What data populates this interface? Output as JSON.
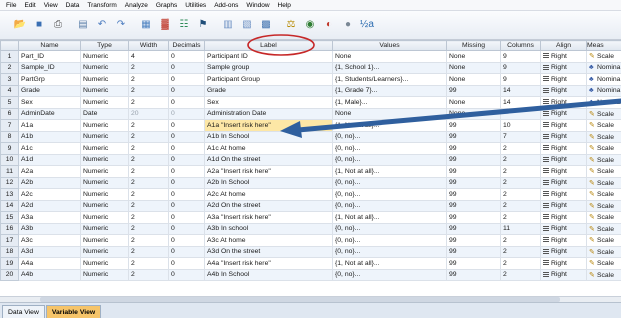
{
  "menu": [
    "File",
    "Edit",
    "View",
    "Data",
    "Transform",
    "Analyze",
    "Graphs",
    "Utilities",
    "Add-ons",
    "Window",
    "Help"
  ],
  "toolbar": {
    "icons": [
      {
        "name": "open-folder-icon",
        "glyph": "📂",
        "color": "#d9a520"
      },
      {
        "name": "save-icon",
        "glyph": "■",
        "color": "#3a6fb3"
      },
      {
        "name": "print-icon",
        "glyph": "⎙",
        "color": "#555555"
      },
      {
        "name": "dialog-recall-icon",
        "glyph": "▤",
        "color": "#5b7fa8"
      },
      {
        "name": "undo-icon",
        "glyph": "↶",
        "color": "#4a7bbf"
      },
      {
        "name": "redo-icon",
        "glyph": "↷",
        "color": "#4a7bbf"
      },
      {
        "name": "goto-case-icon",
        "glyph": "▦",
        "color": "#4a80c0"
      },
      {
        "name": "goto-variable-icon",
        "glyph": "▓",
        "color": "#c0392b"
      },
      {
        "name": "variables-icon",
        "glyph": "☷",
        "color": "#2e8b57"
      },
      {
        "name": "find-icon",
        "glyph": "⚑",
        "color": "#1f4e79"
      },
      {
        "name": "insert-cases-icon",
        "glyph": "▥",
        "color": "#6b8fc2"
      },
      {
        "name": "insert-variable-icon",
        "glyph": "▧",
        "color": "#6b8fc2"
      },
      {
        "name": "split-file-icon",
        "glyph": "▩",
        "color": "#3b6fae"
      },
      {
        "name": "weight-cases-icon",
        "glyph": "⚖",
        "color": "#b58900"
      },
      {
        "name": "select-cases-icon",
        "glyph": "◉",
        "color": "#2e7d32"
      },
      {
        "name": "value-labels-icon",
        "glyph": "◐",
        "color": "#c0392b"
      },
      {
        "name": "use-sets-icon",
        "glyph": "●",
        "color": "#7a8895"
      },
      {
        "name": "spell-check-icon",
        "glyph": "½a",
        "color": "#2b6cb0"
      }
    ]
  },
  "columns": [
    "Name",
    "Type",
    "Width",
    "Decimals",
    "Label",
    "Values",
    "Missing",
    "Columns",
    "Align",
    "Meas"
  ],
  "rows": [
    {
      "n": "1",
      "name": "Part_ID",
      "type": "Numeric",
      "width": "4",
      "dec": "0",
      "label": "Participant ID",
      "values": "None",
      "missing": "None",
      "columns": "9",
      "align": "Right",
      "meas": "Scale",
      "meas_icon": "scale"
    },
    {
      "n": "2",
      "name": "Sample_ID",
      "type": "Numeric",
      "width": "2",
      "dec": "0",
      "label": "Sample group",
      "values": "{1, School 1}...",
      "missing": "None",
      "columns": "9",
      "align": "Right",
      "meas": "Nomina",
      "meas_icon": "nominal"
    },
    {
      "n": "3",
      "name": "PartGrp",
      "type": "Numeric",
      "width": "2",
      "dec": "0",
      "label": "Participant Group",
      "values": "{1, Students/Learners}...",
      "missing": "None",
      "columns": "9",
      "align": "Right",
      "meas": "Nomina",
      "meas_icon": "nominal"
    },
    {
      "n": "4",
      "name": "Grade",
      "type": "Numeric",
      "width": "2",
      "dec": "0",
      "label": "Grade",
      "values": "{1, Grade 7}...",
      "missing": "99",
      "columns": "14",
      "align": "Right",
      "meas": "Nomina",
      "meas_icon": "nominal"
    },
    {
      "n": "5",
      "name": "Sex",
      "type": "Numeric",
      "width": "2",
      "dec": "0",
      "label": "Sex",
      "values": "{1, Male}...",
      "missing": "None",
      "columns": "14",
      "align": "Right",
      "meas": "Nomina",
      "meas_icon": "nominal"
    },
    {
      "n": "6",
      "name": "AdminDate",
      "type": "Date",
      "width": "20",
      "dec": "0",
      "label": "Administration Date",
      "values": "None",
      "missing": "None",
      "columns": "",
      "align": "Right",
      "meas": "Scale",
      "meas_icon": "scale"
    },
    {
      "n": "7",
      "name": "A1a",
      "type": "Numeric",
      "width": "2",
      "dec": "0",
      "label": "A1a \"Insert risk here\"",
      "values": "{1, Not at all}...",
      "missing": "99",
      "columns": "10",
      "align": "Right",
      "meas": "Scale",
      "meas_icon": "scale"
    },
    {
      "n": "8",
      "name": "A1b",
      "type": "Numeric",
      "width": "2",
      "dec": "0",
      "label": "A1b In School",
      "values": "{0, no}...",
      "missing": "99",
      "columns": "7",
      "align": "Right",
      "meas": "Scale",
      "meas_icon": "scale"
    },
    {
      "n": "9",
      "name": "A1c",
      "type": "Numeric",
      "width": "2",
      "dec": "0",
      "label": "A1c At home",
      "values": "{0, no}...",
      "missing": "99",
      "columns": "2",
      "align": "Right",
      "meas": "Scale",
      "meas_icon": "scale"
    },
    {
      "n": "10",
      "name": "A1d",
      "type": "Numeric",
      "width": "2",
      "dec": "0",
      "label": "A1d On the street",
      "values": "{0, no}...",
      "missing": "99",
      "columns": "2",
      "align": "Right",
      "meas": "Scale",
      "meas_icon": "scale"
    },
    {
      "n": "11",
      "name": "A2a",
      "type": "Numeric",
      "width": "2",
      "dec": "0",
      "label": "A2a \"Insert risk here\"",
      "values": "{1, Not at all}...",
      "missing": "99",
      "columns": "2",
      "align": "Right",
      "meas": "Scale",
      "meas_icon": "scale"
    },
    {
      "n": "12",
      "name": "A2b",
      "type": "Numeric",
      "width": "2",
      "dec": "0",
      "label": "A2b In School",
      "values": "{0, no}...",
      "missing": "99",
      "columns": "2",
      "align": "Right",
      "meas": "Scale",
      "meas_icon": "scale"
    },
    {
      "n": "13",
      "name": "A2c",
      "type": "Numeric",
      "width": "2",
      "dec": "0",
      "label": "A2c At home",
      "values": "{0, no}...",
      "missing": "99",
      "columns": "2",
      "align": "Right",
      "meas": "Scale",
      "meas_icon": "scale"
    },
    {
      "n": "14",
      "name": "A2d",
      "type": "Numeric",
      "width": "2",
      "dec": "0",
      "label": "A2d On the street",
      "values": "{0, no}...",
      "missing": "99",
      "columns": "2",
      "align": "Right",
      "meas": "Scale",
      "meas_icon": "scale"
    },
    {
      "n": "15",
      "name": "A3a",
      "type": "Numeric",
      "width": "2",
      "dec": "0",
      "label": "A3a \"Insert risk here\"",
      "values": "{1, Not at all}...",
      "missing": "99",
      "columns": "2",
      "align": "Right",
      "meas": "Scale",
      "meas_icon": "scale"
    },
    {
      "n": "16",
      "name": "A3b",
      "type": "Numeric",
      "width": "2",
      "dec": "0",
      "label": "A3b In school",
      "values": "{0, no}...",
      "missing": "99",
      "columns": "11",
      "align": "Right",
      "meas": "Scale",
      "meas_icon": "scale"
    },
    {
      "n": "17",
      "name": "A3c",
      "type": "Numeric",
      "width": "2",
      "dec": "0",
      "label": "A3c At home",
      "values": "{0, no}...",
      "missing": "99",
      "columns": "2",
      "align": "Right",
      "meas": "Scale",
      "meas_icon": "scale"
    },
    {
      "n": "18",
      "name": "A3d",
      "type": "Numeric",
      "width": "2",
      "dec": "0",
      "label": "A3d On the street",
      "values": "{0, no}...",
      "missing": "99",
      "columns": "2",
      "align": "Right",
      "meas": "Scale",
      "meas_icon": "scale"
    },
    {
      "n": "19",
      "name": "A4a",
      "type": "Numeric",
      "width": "2",
      "dec": "0",
      "label": "A4a \"Insert risk here\"",
      "values": "{1, Not at all}...",
      "missing": "99",
      "columns": "2",
      "align": "Right",
      "meas": "Scale",
      "meas_icon": "scale"
    },
    {
      "n": "20",
      "name": "A4b",
      "type": "Numeric",
      "width": "2",
      "dec": "0",
      "label": "A4b In School",
      "values": "{0, no}...",
      "missing": "99",
      "columns": "2",
      "align": "Right",
      "meas": "Scale",
      "meas_icon": "scale"
    }
  ],
  "highlighted_row": "7",
  "tabs": [
    {
      "label": "Data View",
      "active": false
    },
    {
      "label": "Variable View",
      "active": true
    }
  ],
  "annotations": {
    "circle_color": "#c62828",
    "arrow_color": "#2f5f9e",
    "highlight_color": "#fde7a6"
  }
}
